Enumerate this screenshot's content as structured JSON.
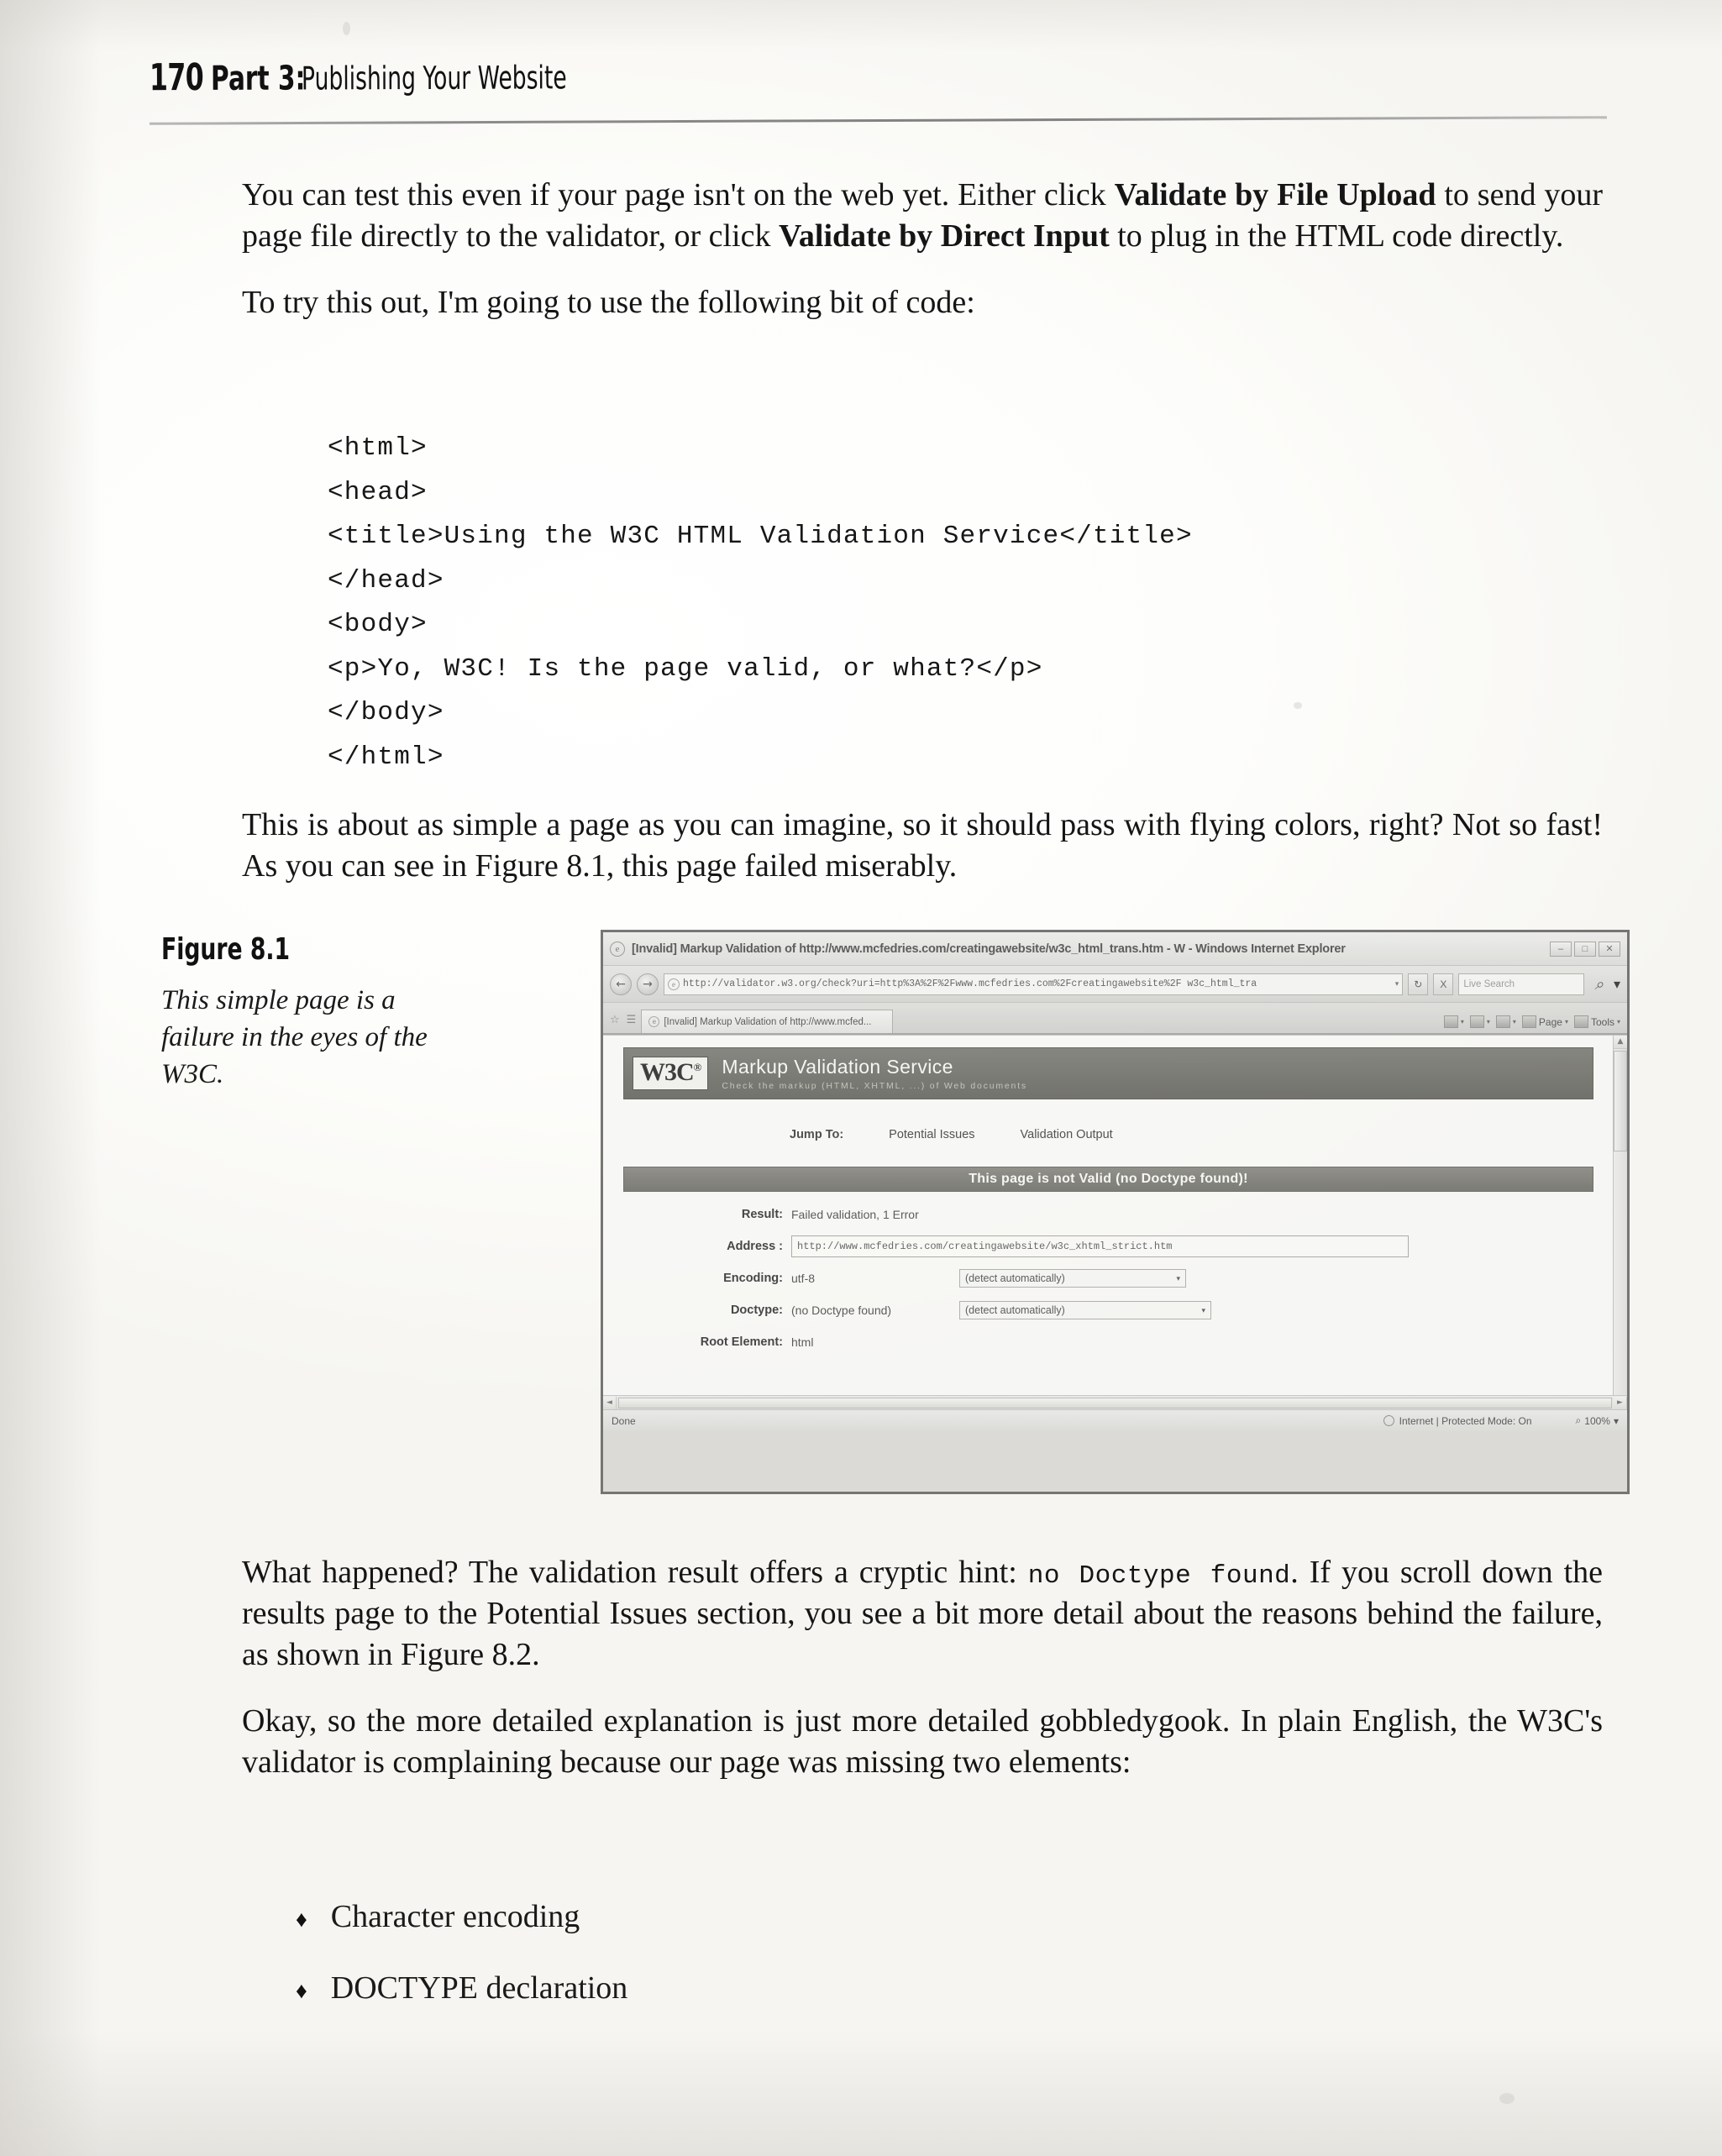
{
  "running_head": {
    "page_number": "170",
    "part": "Part 3:",
    "part_title": "Publishing Your Website"
  },
  "body": {
    "para1_a": "You can test this even if your page isn't on the web yet. Either click ",
    "para1_b": "Validate by File Upload",
    "para1_c": " to send your page file directly to the validator, or click ",
    "para1_d": "Validate by Direct Input",
    "para1_e": " to plug in the HTML code directly.",
    "para2": "To try this out, I'm going to use the following bit of code:",
    "para3": "This is about as simple a page as you can imagine, so it should pass with flying colors, right? Not so fast! As you can see in Figure 8.1, this page failed miserably.",
    "para4_a": "What happened? The validation result offers a cryptic hint: ",
    "para4_mono": "no Doctype found",
    "para4_b": ". If you scroll down the results page to the Potential Issues section, you see a bit more detail about the reasons behind the failure, as shown in Figure 8.2.",
    "para5": "Okay, so the more detailed explanation is just more detailed gobbledygook. In plain English, the W3C's validator is complaining because our page was missing two elements:",
    "bullets": [
      "Character encoding",
      "DOCTYPE declaration"
    ],
    "bullet_glyph": "♦"
  },
  "code_block": {
    "lines": [
      "<html>",
      "<head>",
      "<title>Using the W3C HTML Validation Service</title>",
      "</head>",
      "<body>",
      "<p>Yo, W3C! Is the page valid, or what?</p>",
      "</body>",
      "</html>"
    ]
  },
  "figure": {
    "number": "Figure 8.1",
    "caption": "This simple page is a failure in the eyes of the W3C."
  },
  "browser": {
    "title": "[Invalid] Markup Validation of http://www.mcfedries.com/creatingawebsite/w3c_html_trans.htm - W - Windows Internet Explorer",
    "window_buttons": [
      "–",
      "□",
      "✕"
    ],
    "back_glyph": "←",
    "forward_glyph": "→",
    "address_value": "http://validator.w3.org/check?uri=http%3A%2F%2Fwww.mcfedries.com%2Fcreatingawebsite%2F w3c_html_tra",
    "address_caret": "▾",
    "refresh_label": "↻",
    "stop_label": "X",
    "search_placeholder": "Live Search",
    "search_magnifier": "⌕",
    "tab_label": "[Invalid] Markup Validation of http://www.mcfed...",
    "fav_buttons": [
      "☆",
      "☰"
    ],
    "command_bar": [
      {
        "label": "",
        "caret": "▾"
      },
      {
        "label": "",
        "caret": "▾"
      },
      {
        "label": "",
        "caret": "▾"
      },
      {
        "label": "Page",
        "caret": "▾"
      },
      {
        "label": "Tools",
        "caret": "▾"
      }
    ],
    "scroll_up": "▲",
    "scroll_down": "▼",
    "scroll_left": "◄",
    "scroll_right": "►",
    "status_text": "Done",
    "status_zone": "Internet | Protected Mode: On",
    "status_zoom": "100%",
    "status_zoom_caret": "▾"
  },
  "validator": {
    "logo": "W3C",
    "logo_sup": "®",
    "heading": "Markup Validation Service",
    "subheading": "Check the markup (HTML, XHTML, ...) of Web documents",
    "jump_to_label": "Jump To:",
    "jump_links": [
      "Potential Issues",
      "Validation Output"
    ],
    "result_banner": "This page is not Valid (no Doctype found)!",
    "rows": [
      {
        "label": "Result:",
        "value": "Failed validation, 1 Error"
      },
      {
        "label": "Address :",
        "value": "http://www.mcfedries.com/creatingawebsite/w3c_xhtml_strict.htm"
      },
      {
        "label": "Encoding:",
        "value": "utf-8",
        "select": "(detect automatically)"
      },
      {
        "label": "Doctype:",
        "value": "(no Doctype found)",
        "select": "(detect automatically)"
      },
      {
        "label": "Root Element:",
        "value": "html"
      }
    ],
    "select_caret": "▾"
  },
  "colors": {
    "paper": "#fdfdfb",
    "ink": "#151515",
    "banner": "#62625b",
    "chrome": "#d6d6d3"
  }
}
